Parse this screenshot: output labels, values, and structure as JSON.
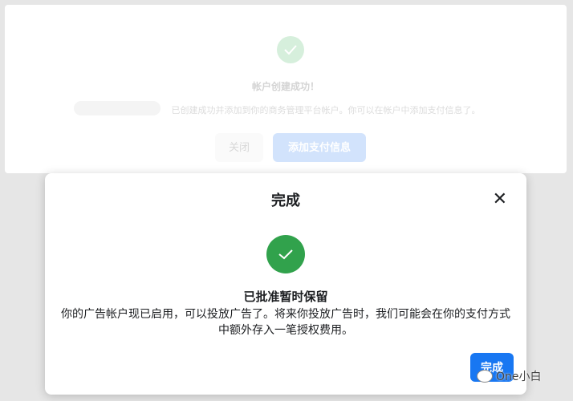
{
  "background_dialog": {
    "title": "帐户创建成功！",
    "message": "已创建成功并添加到你的商务管理平台帐户。你可以在帐户中添加支付信息了。",
    "close_label": "关闭",
    "add_payment_label": "添加支付信息"
  },
  "dialog": {
    "title": "完成",
    "heading": "已批准暂时保留",
    "message": "你的广告帐户现已启用，可以投放广告了。将来你投放广告时，我们可能会在你的支付方式中额外存入一笔授权费用。",
    "done_label": "完成"
  },
  "watermark": "One小白"
}
